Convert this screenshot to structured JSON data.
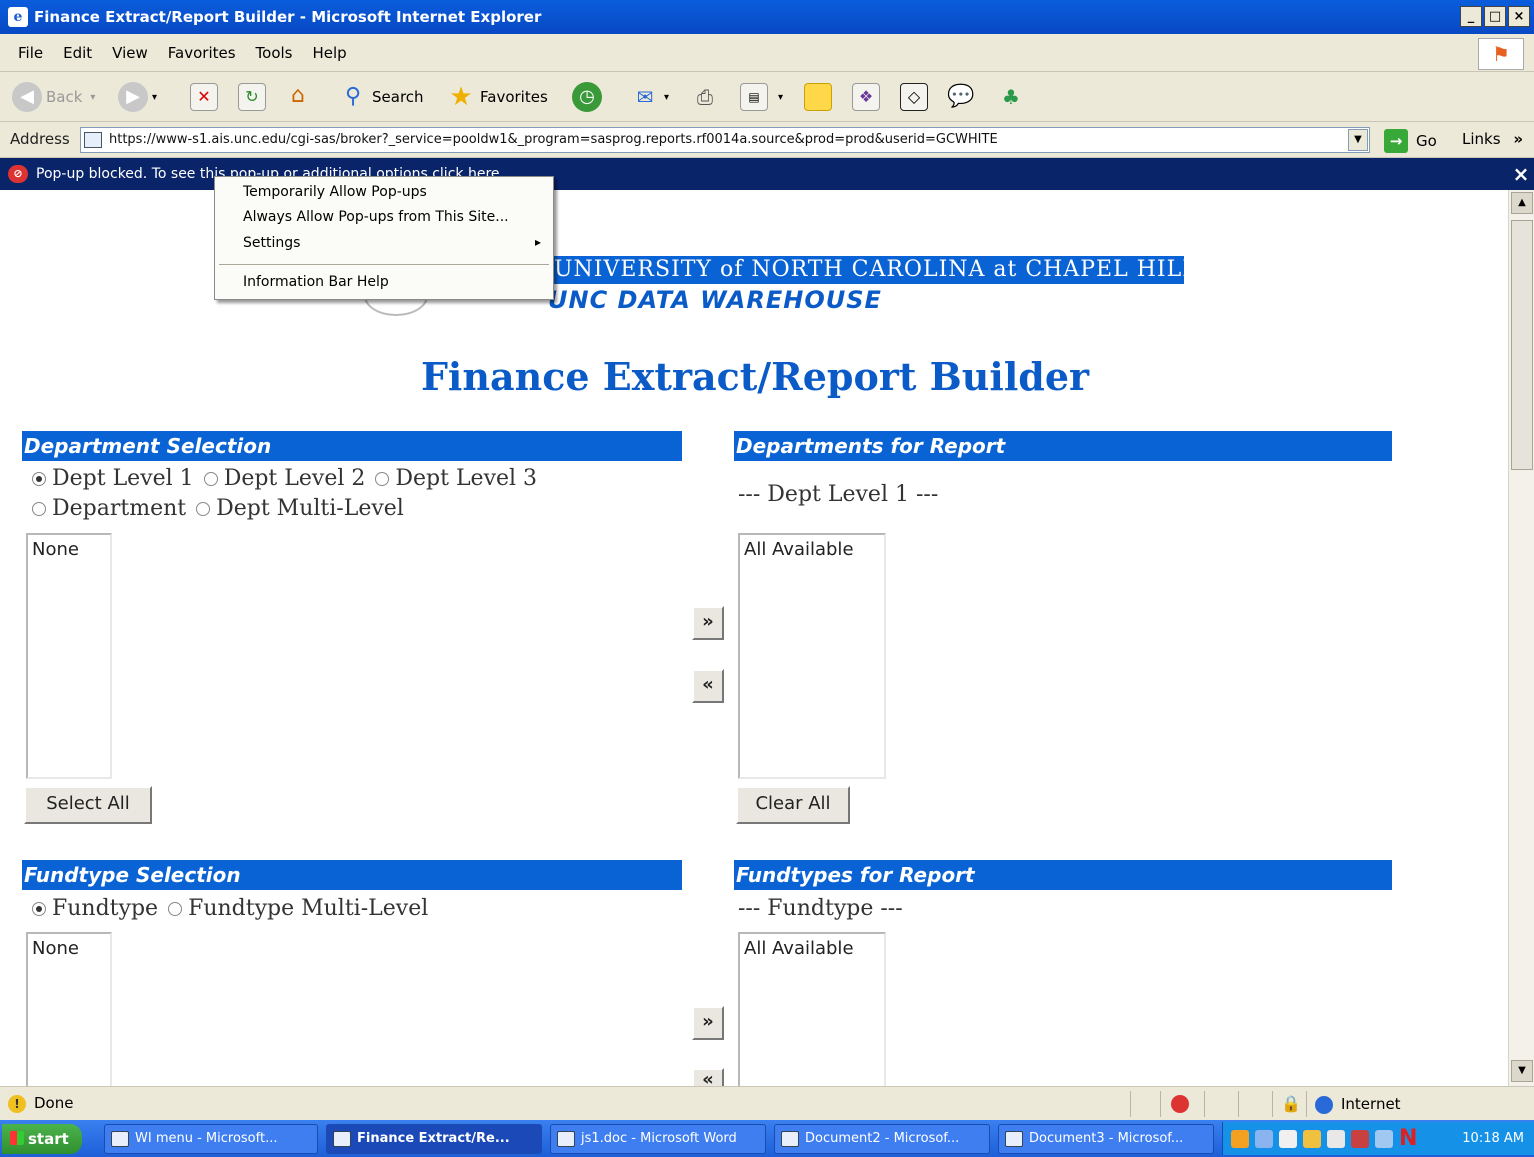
{
  "window": {
    "title": "Finance Extract/Report Builder - Microsoft Internet Explorer",
    "controls": [
      "_",
      "□",
      "×"
    ]
  },
  "menubar": [
    "File",
    "Edit",
    "View",
    "Favorites",
    "Tools",
    "Help"
  ],
  "toolbar": {
    "back": "Back",
    "search": "Search",
    "favorites": "Favorites"
  },
  "addressbar": {
    "label": "Address",
    "url": "https://www-s1.ais.unc.edu/cgi-sas/broker?_service=pooldw1&_program=sasprog.reports.rf0014a.source&prod=prod&userid=GCWHITE",
    "go": "Go",
    "links": "Links",
    "links_chevron": "»"
  },
  "infobar": {
    "text": "Pop-up blocked. To see this pop-up or additional options click here...",
    "close": "×"
  },
  "popup_menu": {
    "items": [
      "Temporarily Allow Pop-ups",
      "Always Allow Pop-ups from This Site...",
      "Settings",
      "Information Bar Help"
    ],
    "submenu_arrow": "▸"
  },
  "page": {
    "unc_banner": "UNIVERSITY of NORTH CAROLINA at CHAPEL HILL",
    "unc_subtitle": "UNC DATA WAREHOUSE",
    "title": "Finance Extract/Report Builder",
    "department": {
      "selection_header": "Department Selection",
      "report_header": "Departments for Report",
      "options": [
        "Dept Level 1",
        "Dept Level 2",
        "Dept Level 3",
        "Department",
        "Dept Multi-Level"
      ],
      "selected_option": "Dept Level 1",
      "source_list": [
        "None"
      ],
      "report_caption": "--- Dept Level 1 ---",
      "report_list": [
        "All Available"
      ],
      "add_button": "»",
      "remove_button": "«",
      "select_all": "Select All",
      "clear_all": "Clear All"
    },
    "fundtype": {
      "selection_header": "Fundtype Selection",
      "report_header": "Fundtypes for Report",
      "options": [
        "Fundtype",
        "Fundtype Multi-Level"
      ],
      "selected_option": "Fundtype",
      "source_list": [
        "None"
      ],
      "report_caption": "--- Fundtype ---",
      "report_list": [
        "All Available"
      ],
      "add_button": "»",
      "remove_button": "«"
    }
  },
  "statusbar": {
    "text": "Done",
    "zone": "Internet"
  },
  "taskbar": {
    "start": "start",
    "tasks": [
      "WI menu - Microsoft...",
      "Finance Extract/Re...",
      "js1.doc - Microsoft Word",
      "Document2 - Microsof...",
      "Document3 - Microsof..."
    ],
    "active_task": "Finance Extract/Re...",
    "clock": "10:18 AM"
  }
}
